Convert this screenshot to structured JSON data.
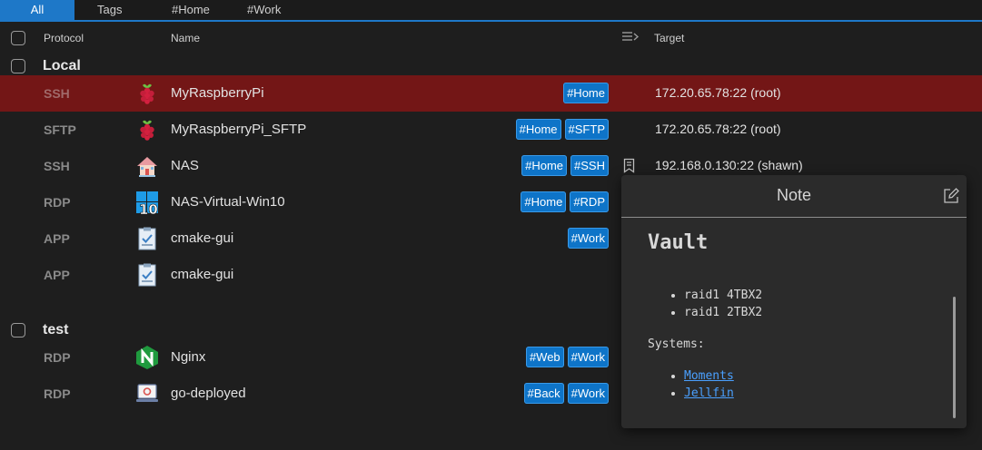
{
  "tabs": [
    {
      "label": "All",
      "active": true
    },
    {
      "label": "Tags"
    },
    {
      "label": "#Home"
    },
    {
      "label": "#Work"
    }
  ],
  "header": {
    "protocol": "Protocol",
    "name": "Name",
    "target": "Target",
    "columns_icon": "columns-toggle-icon"
  },
  "groups": [
    {
      "name": "Local",
      "rows": [
        {
          "protocol": "SSH",
          "name": "MyRaspberryPi",
          "icon": "raspberry-pi-icon",
          "tags": [
            "#Home"
          ],
          "target": "172.20.65.78:22 (root)",
          "selected": true
        },
        {
          "protocol": "SFTP",
          "name": "MyRaspberryPi_SFTP",
          "icon": "raspberry-pi-icon",
          "tags": [
            "#Home",
            "#SFTP"
          ],
          "target": "172.20.65.78:22 (root)"
        },
        {
          "protocol": "SSH",
          "name": "NAS",
          "icon": "house-icon",
          "tags": [
            "#Home",
            "#SSH"
          ],
          "target": "192.168.0.130:22 (shawn)",
          "has_note": true
        },
        {
          "protocol": "RDP",
          "name": "NAS-Virtual-Win10",
          "icon": "windows-10-icon",
          "tags": [
            "#Home",
            "#RDP"
          ],
          "target": ""
        },
        {
          "protocol": "APP",
          "name": "cmake-gui",
          "icon": "clipboard-app-icon",
          "tags": [
            "#Work"
          ],
          "target": ""
        },
        {
          "protocol": "APP",
          "name": "cmake-gui",
          "icon": "clipboard-app-icon",
          "tags": [],
          "target": ""
        }
      ]
    },
    {
      "name": "test",
      "rows": [
        {
          "protocol": "RDP",
          "name": "Nginx",
          "icon": "nginx-icon",
          "tags": [
            "#Web",
            "#Work"
          ],
          "target": ""
        },
        {
          "protocol": "RDP",
          "name": "go-deployed",
          "icon": "deploy-monitor-icon",
          "tags": [
            "#Back",
            "#Work"
          ],
          "target": ""
        }
      ]
    }
  ],
  "note_popup": {
    "title": "Note",
    "heading": "Vault",
    "items": [
      "raid1 4TBX2",
      "raid1 2TBX2"
    ],
    "systems_label": "Systems:",
    "links": [
      "Moments",
      "Jellfin"
    ]
  },
  "colors": {
    "accent": "#1e78c8",
    "selected_row": "#731616",
    "tag": "#0e74c8",
    "link": "#4aa0ff"
  }
}
